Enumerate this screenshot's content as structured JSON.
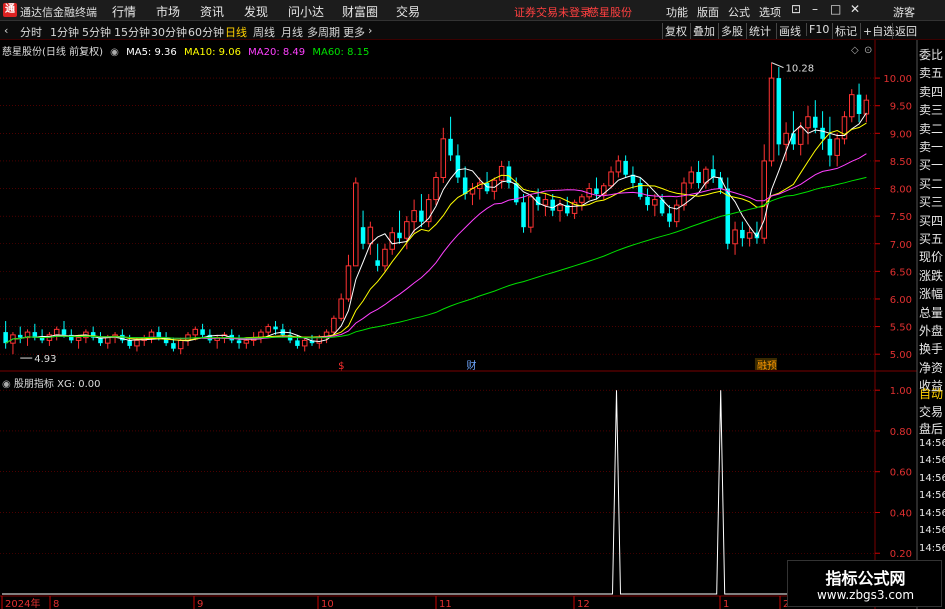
{
  "app": {
    "title": "通达信金融终端"
  },
  "menu": [
    "行情",
    "市场",
    "资讯",
    "发现",
    "问小达",
    "财富圈",
    "交易"
  ],
  "menu_alert": "证券交易未登录",
  "menu_stock": "慈星股份",
  "menu_right": [
    "功能",
    "版面",
    "公式",
    "选项"
  ],
  "menu_user": "游客",
  "toolbar": {
    "periods": [
      "分时",
      "1分钟",
      "5分钟",
      "15分钟",
      "30分钟",
      "60分钟",
      "日线",
      "周线",
      "月线",
      "多周期",
      "更多"
    ],
    "active_index": 6,
    "right": [
      "复权",
      "叠加",
      "多股",
      "统计",
      "画线",
      "F10",
      "标记",
      "+自选",
      "返回"
    ]
  },
  "legend": {
    "stock": "慈星股份(日线 前复权)",
    "ma": [
      {
        "label": "MA5: 9.36",
        "color": "#ffffff"
      },
      {
        "label": "MA10: 9.06",
        "color": "#ffff00"
      },
      {
        "label": "MA20: 8.49",
        "color": "#ff40ff"
      },
      {
        "label": "MA60: 8.15",
        "color": "#00e000"
      }
    ]
  },
  "annotations": {
    "high": "10.28",
    "low": "4.93",
    "marker_s": "$",
    "marker_cai": "财",
    "marker_jiu": "融预"
  },
  "indicator": {
    "name": "股朋指标",
    "value": "XG: 0.00"
  },
  "dates": [
    "2024年",
    "8",
    "9",
    "10",
    "11",
    "12",
    "1",
    "2"
  ],
  "side_top": [
    "委比",
    "卖五",
    "卖四",
    "卖三",
    "卖二",
    "卖一",
    "买一",
    "买二",
    "买三",
    "买四",
    "买五",
    "现价",
    "涨跌",
    "涨幅",
    "总量",
    "外盘",
    "换手",
    "净资",
    "收益"
  ],
  "side_bottom": [
    "自动",
    "交易",
    "盘后",
    "14:56",
    "14:56",
    "14:56",
    "14:56",
    "14:56",
    "14:56",
    "14:56"
  ],
  "watermark": {
    "title": "指标公式网",
    "url": "www.zbgs3.com"
  },
  "colors": {
    "up": "#ff3333",
    "down": "#00ffff",
    "ma5": "#ffffff",
    "ma10": "#ffff00",
    "ma20": "#ff40ff",
    "ma60": "#00e000",
    "grid": "#7a0000"
  },
  "chart_data": [
    {
      "type": "candlestick",
      "title": "慈星股份(日线 前复权)",
      "y_ticks": [
        10.0,
        9.5,
        9.0,
        8.5,
        8.0,
        7.5,
        7.0,
        6.5,
        6.0,
        5.5,
        5.0
      ],
      "ylim": [
        4.75,
        10.4
      ],
      "x_labels": [
        "2024年",
        "8",
        "9",
        "10",
        "11",
        "12",
        "1",
        "2"
      ],
      "high_label": 10.28,
      "low_label": 4.93,
      "candles": [
        [
          5.4,
          5.6,
          5.1,
          5.2
        ],
        [
          5.2,
          5.4,
          5.0,
          5.35
        ],
        [
          5.35,
          5.5,
          5.2,
          5.3
        ],
        [
          5.3,
          5.45,
          5.15,
          5.4
        ],
        [
          5.4,
          5.55,
          5.25,
          5.3
        ],
        [
          5.3,
          5.45,
          5.2,
          5.25
        ],
        [
          5.25,
          5.4,
          5.15,
          5.35
        ],
        [
          5.35,
          5.5,
          5.25,
          5.45
        ],
        [
          5.45,
          5.6,
          5.3,
          5.35
        ],
        [
          5.35,
          5.45,
          5.2,
          5.25
        ],
        [
          5.25,
          5.35,
          5.1,
          5.3
        ],
        [
          5.3,
          5.45,
          5.2,
          5.4
        ],
        [
          5.4,
          5.5,
          5.25,
          5.3
        ],
        [
          5.3,
          5.4,
          5.15,
          5.2
        ],
        [
          5.2,
          5.35,
          5.1,
          5.3
        ],
        [
          5.3,
          5.4,
          5.2,
          5.35
        ],
        [
          5.35,
          5.45,
          5.2,
          5.25
        ],
        [
          5.25,
          5.35,
          5.1,
          5.15
        ],
        [
          5.15,
          5.3,
          5.05,
          5.25
        ],
        [
          5.25,
          5.35,
          5.15,
          5.3
        ],
        [
          5.3,
          5.45,
          5.2,
          5.4
        ],
        [
          5.4,
          5.5,
          5.25,
          5.3
        ],
        [
          5.3,
          5.4,
          5.15,
          5.2
        ],
        [
          5.2,
          5.3,
          5.05,
          5.1
        ],
        [
          5.1,
          5.3,
          5.0,
          5.25
        ],
        [
          5.25,
          5.4,
          5.15,
          5.35
        ],
        [
          5.35,
          5.5,
          5.25,
          5.45
        ],
        [
          5.45,
          5.55,
          5.3,
          5.35
        ],
        [
          5.35,
          5.45,
          5.2,
          5.25
        ],
        [
          5.25,
          5.35,
          5.1,
          5.3
        ],
        [
          5.3,
          5.4,
          5.2,
          5.35
        ],
        [
          5.35,
          5.45,
          5.2,
          5.25
        ],
        [
          5.25,
          5.35,
          5.1,
          5.2
        ],
        [
          5.2,
          5.3,
          5.1,
          5.25
        ],
        [
          5.25,
          5.4,
          5.15,
          5.3
        ],
        [
          5.3,
          5.45,
          5.2,
          5.4
        ],
        [
          5.4,
          5.55,
          5.3,
          5.5
        ],
        [
          5.5,
          5.6,
          5.35,
          5.45
        ],
        [
          5.45,
          5.55,
          5.3,
          5.35
        ],
        [
          5.35,
          5.45,
          5.2,
          5.25
        ],
        [
          5.25,
          5.35,
          5.1,
          5.15
        ],
        [
          5.15,
          5.3,
          5.05,
          5.25
        ],
        [
          5.25,
          5.35,
          5.15,
          5.2
        ],
        [
          5.2,
          5.35,
          5.1,
          5.3
        ],
        [
          5.3,
          5.45,
          5.2,
          5.4
        ],
        [
          5.4,
          5.7,
          5.35,
          5.65
        ],
        [
          5.65,
          6.1,
          5.6,
          6.0
        ],
        [
          6.0,
          6.8,
          5.95,
          6.6
        ],
        [
          6.6,
          8.2,
          6.6,
          8.1
        ],
        [
          7.3,
          7.6,
          6.9,
          7.0
        ],
        [
          7.0,
          7.4,
          6.8,
          7.3
        ],
        [
          6.7,
          7.0,
          6.5,
          6.6
        ],
        [
          6.6,
          7.0,
          6.5,
          6.9
        ],
        [
          6.9,
          7.3,
          6.8,
          7.2
        ],
        [
          7.2,
          7.6,
          7.0,
          7.1
        ],
        [
          7.1,
          7.5,
          6.9,
          7.4
        ],
        [
          7.4,
          7.8,
          7.2,
          7.6
        ],
        [
          7.6,
          7.9,
          7.3,
          7.4
        ],
        [
          7.4,
          7.9,
          7.3,
          7.8
        ],
        [
          7.8,
          8.3,
          7.7,
          8.2
        ],
        [
          8.2,
          9.1,
          8.1,
          8.9
        ],
        [
          8.9,
          9.3,
          8.5,
          8.6
        ],
        [
          8.6,
          8.8,
          8.1,
          8.2
        ],
        [
          8.2,
          8.4,
          7.8,
          7.9
        ],
        [
          7.9,
          8.1,
          7.7,
          8.0
        ],
        [
          8.0,
          8.2,
          7.8,
          8.1
        ],
        [
          8.1,
          8.3,
          7.9,
          7.95
        ],
        [
          7.95,
          8.2,
          7.8,
          8.15
        ],
        [
          8.15,
          8.5,
          8.0,
          8.4
        ],
        [
          8.4,
          8.5,
          8.0,
          8.1
        ],
        [
          8.1,
          8.2,
          7.7,
          7.75
        ],
        [
          7.75,
          7.9,
          7.2,
          7.3
        ],
        [
          7.3,
          7.9,
          7.2,
          7.85
        ],
        [
          7.85,
          8.0,
          7.6,
          7.7
        ],
        [
          7.7,
          7.9,
          7.5,
          7.8
        ],
        [
          7.8,
          7.9,
          7.5,
          7.6
        ],
        [
          7.6,
          7.8,
          7.4,
          7.7
        ],
        [
          7.7,
          7.85,
          7.5,
          7.55
        ],
        [
          7.55,
          7.8,
          7.45,
          7.75
        ],
        [
          7.75,
          7.9,
          7.6,
          7.85
        ],
        [
          7.85,
          8.1,
          7.8,
          8.0
        ],
        [
          8.0,
          8.2,
          7.8,
          7.9
        ],
        [
          7.9,
          8.1,
          7.8,
          8.05
        ],
        [
          8.05,
          8.4,
          8.0,
          8.3
        ],
        [
          8.3,
          8.6,
          8.2,
          8.5
        ],
        [
          8.5,
          8.6,
          8.2,
          8.25
        ],
        [
          8.25,
          8.4,
          8.0,
          8.1
        ],
        [
          8.1,
          8.2,
          7.8,
          7.85
        ],
        [
          7.85,
          8.0,
          7.6,
          7.7
        ],
        [
          7.7,
          7.9,
          7.5,
          7.8
        ],
        [
          7.8,
          7.9,
          7.5,
          7.55
        ],
        [
          7.55,
          7.7,
          7.3,
          7.4
        ],
        [
          7.4,
          7.8,
          7.3,
          7.7
        ],
        [
          7.7,
          8.2,
          7.6,
          8.1
        ],
        [
          8.1,
          8.4,
          8.0,
          8.3
        ],
        [
          8.3,
          8.5,
          8.0,
          8.1
        ],
        [
          8.1,
          8.4,
          8.0,
          8.35
        ],
        [
          8.35,
          8.6,
          8.1,
          8.2
        ],
        [
          8.2,
          8.3,
          7.9,
          8.0
        ],
        [
          8.0,
          8.2,
          6.9,
          7.0
        ],
        [
          7.0,
          7.4,
          6.8,
          7.25
        ],
        [
          7.25,
          7.4,
          6.95,
          7.1
        ],
        [
          7.1,
          7.3,
          6.95,
          7.2
        ],
        [
          7.2,
          7.4,
          7.0,
          7.1
        ],
        [
          7.1,
          8.8,
          7.0,
          8.5
        ],
        [
          8.5,
          10.28,
          8.4,
          10.0
        ],
        [
          10.0,
          10.2,
          8.6,
          8.8
        ],
        [
          8.8,
          9.2,
          8.5,
          9.0
        ],
        [
          9.0,
          9.4,
          8.7,
          8.8
        ],
        [
          8.8,
          9.2,
          8.6,
          9.1
        ],
        [
          9.1,
          9.5,
          8.8,
          9.3
        ],
        [
          9.3,
          9.6,
          9.0,
          9.1
        ],
        [
          9.1,
          9.4,
          8.7,
          8.9
        ],
        [
          8.9,
          9.3,
          8.4,
          8.6
        ],
        [
          8.6,
          9.0,
          8.4,
          8.9
        ],
        [
          8.9,
          9.4,
          8.8,
          9.3
        ],
        [
          9.3,
          9.8,
          9.2,
          9.7
        ],
        [
          9.7,
          9.9,
          9.2,
          9.35
        ],
        [
          9.35,
          9.7,
          9.2,
          9.6
        ]
      ],
      "series": [
        {
          "name": "MA5",
          "color": "#ffffff"
        },
        {
          "name": "MA10",
          "color": "#ffff00"
        },
        {
          "name": "MA20",
          "color": "#ff40ff"
        },
        {
          "name": "MA60",
          "color": "#00e000"
        }
      ]
    },
    {
      "type": "line",
      "title": "股朋指标",
      "series_name": "XG",
      "y_ticks": [
        1.0,
        0.8,
        0.6,
        0.4,
        0.2
      ],
      "ylim": [
        0,
        1.05
      ],
      "spikes": [
        {
          "index": 88,
          "value": 1.0
        },
        {
          "index": 103,
          "value": 1.0
        }
      ],
      "total_points": 125
    }
  ]
}
